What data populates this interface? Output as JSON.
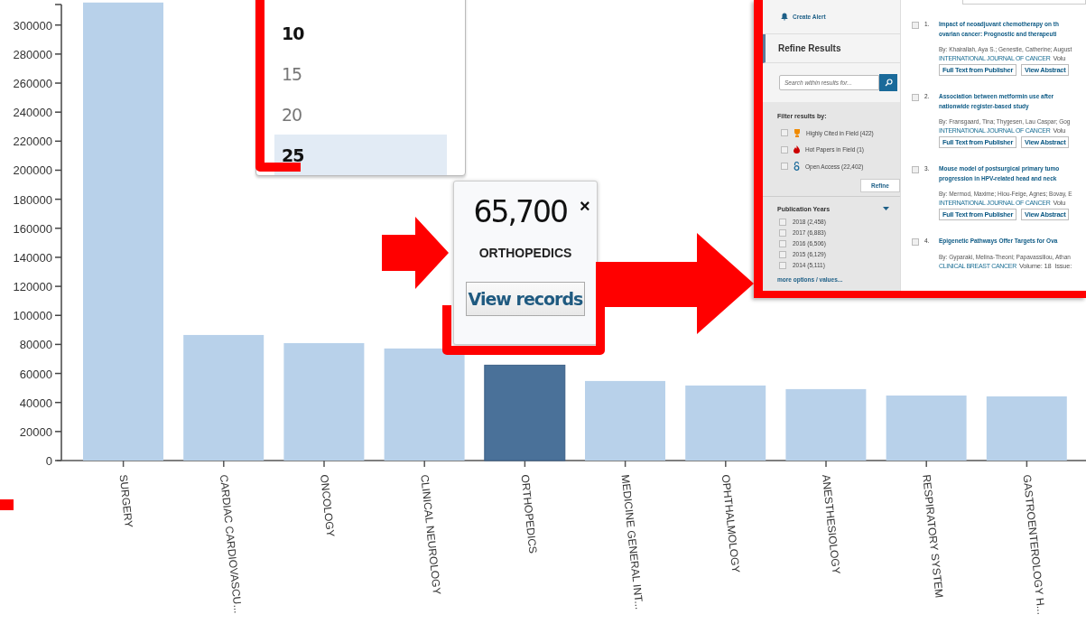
{
  "chart": {
    "chart_data": {
      "type": "bar",
      "categories": [
        "SURGERY",
        "CARDIAC CARDIOVASCU...",
        "ONCOLOGY",
        "CLINICAL NEUROLOGY",
        "ORTHOPEDICS",
        "MEDICINE GENERAL INT...",
        "OPHTHALMOLOGY",
        "ANESTHESIOLOGY",
        "RESPIRATORY SYSTEM",
        "GASTROENTEROLOGY H..."
      ],
      "series": [
        {
          "color": "#b8d1ea",
          "values": [
            315500,
            86500,
            80900,
            77200,
            null,
            54800,
            51700,
            49200,
            44800,
            44200
          ]
        },
        {
          "color": "#4a7199",
          "values": [
            null,
            null,
            null,
            null,
            65700,
            null,
            null,
            null,
            null,
            null
          ]
        }
      ],
      "stacked": true,
      "ylim": [
        0,
        316000
      ],
      "yticks": [
        0,
        20000,
        40000,
        60000,
        80000,
        100000,
        120000,
        140000,
        160000,
        180000,
        200000,
        220000,
        240000,
        260000,
        280000,
        300000
      ]
    },
    "selected_bar": [
      false,
      false,
      false,
      false,
      true,
      false,
      false,
      false,
      false,
      false
    ]
  },
  "page_size_menu": {
    "items": [
      {
        "label": "10",
        "current": true,
        "selected": false
      },
      {
        "label": "15",
        "current": false,
        "selected": false
      },
      {
        "label": "20",
        "current": false,
        "selected": false
      },
      {
        "label": "25",
        "current": false,
        "selected": true
      }
    ]
  },
  "tooltip": {
    "value": "65,700",
    "close": "×",
    "label": "ORTHOPEDICS",
    "button": "View records"
  },
  "inset": {
    "create_alert": "Create Alert",
    "refine_title": "Refine Results",
    "search": {
      "placeholder": "Search within results for..."
    },
    "filter_title": "Filter results by:",
    "filters": [
      {
        "kind": "trophy",
        "label": "Highly Cited in Field (422)",
        "checked": false
      },
      {
        "kind": "flame",
        "label": "Hot Papers in Field (1)",
        "checked": false
      },
      {
        "kind": "open",
        "label": "Open Access (22,402)",
        "checked": false
      }
    ],
    "refine_button": "Refine",
    "years_title": "Publication Years",
    "years": [
      {
        "label": "2018 (2,458)",
        "checked": false
      },
      {
        "label": "2017 (6,883)",
        "checked": false
      },
      {
        "label": "2016 (6,506)",
        "checked": false
      },
      {
        "label": "2015 (6,129)",
        "checked": false
      },
      {
        "label": "2014 (5,111)",
        "checked": false
      }
    ],
    "more_options": "more options / values...",
    "results": [
      {
        "number": "1.",
        "checked": false,
        "title_lines": [
          "Impact of neoadjuvant chemotherapy on th",
          "ovarian cancer: Prognostic and therapeuti"
        ],
        "authors": "By: Khairallah, Aya S.; Genestie, Catherine; August",
        "journal": "INTERNATIONAL JOURNAL OF CANCER",
        "meta": "Volu",
        "buttons": [
          "Full Text from Publisher",
          "View Abstract"
        ]
      },
      {
        "number": "2.",
        "checked": false,
        "title_lines": [
          "Association between metformin use after",
          "nationwide register-based study"
        ],
        "authors": "By: Fransgaard, Tina; Thygesen, Lau Caspar; Gog",
        "journal": "INTERNATIONAL JOURNAL OF CANCER",
        "meta": "Volu",
        "buttons": [
          "Full Text from Publisher",
          "View Abstract"
        ]
      },
      {
        "number": "3.",
        "checked": false,
        "title_lines": [
          "Mouse model of postsurgical primary tumo",
          "progression in HPV-related head and neck"
        ],
        "authors": "By: Mermod, Maxime; Hiou-Feige, Agnes; Bovay, E",
        "journal": "INTERNATIONAL JOURNAL OF CANCER",
        "meta": "Volu",
        "buttons": [
          "Full Text from Publisher",
          "View Abstract"
        ]
      },
      {
        "number": "4.",
        "checked": false,
        "title_lines": [
          "Epigenetic Pathways Offer Targets for Ova"
        ],
        "authors": "By: Gyparaki, Melina-Theoni; Papavassiliou, Athan",
        "journal": "CLINICAL BREAST CANCER",
        "meta": "Volume: 18  Issue:"
      }
    ]
  }
}
